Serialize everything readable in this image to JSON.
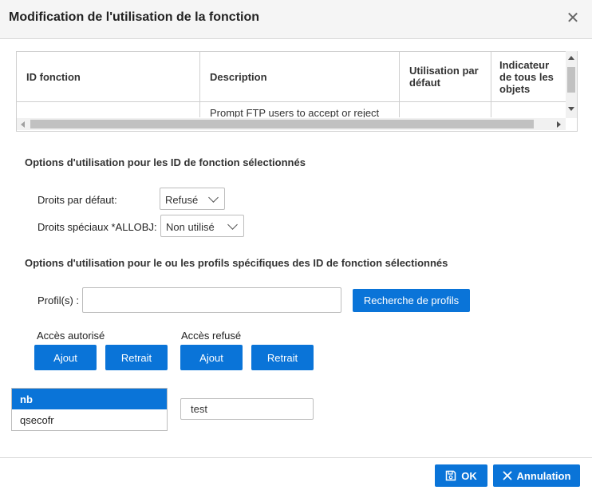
{
  "dialog": {
    "title": "Modification de l'utilisation de la fonction",
    "close_icon": "close-icon"
  },
  "table": {
    "columns": [
      "ID fonction",
      "Description",
      "Utilisation par défaut",
      "Indicateur de tous les objets"
    ],
    "rows": [
      {
        "id": "",
        "description": "Prompt FTP users to accept or reject",
        "default_usage": "",
        "all_objects": ""
      }
    ]
  },
  "options_selected": {
    "heading": "Options d'utilisation pour les ID de fonction sélectionnés",
    "default_rights_label": "Droits par défaut:",
    "default_rights_value": "Refusé",
    "special_rights_label": "Droits spéciaux *ALLOBJ:",
    "special_rights_value": "Non utilisé"
  },
  "options_profiles": {
    "heading": "Options d'utilisation pour le ou les profils spécifiques des ID de fonction sélectionnés",
    "profiles_label": "Profil(s) :",
    "profiles_value": "",
    "search_button": "Recherche de profils",
    "allowed_label": "Accès autorisé",
    "denied_label": "Accès refusé",
    "add_label": "Ajout",
    "remove_label": "Retrait",
    "allowed_list": [
      "nb",
      "qsecofr"
    ],
    "allowed_selected": "nb",
    "denied_list": [
      "test"
    ]
  },
  "footer": {
    "ok_label": "OK",
    "cancel_label": "Annulation"
  },
  "colors": {
    "accent": "#0a74d8",
    "header_bg": "#f5f5f5"
  }
}
